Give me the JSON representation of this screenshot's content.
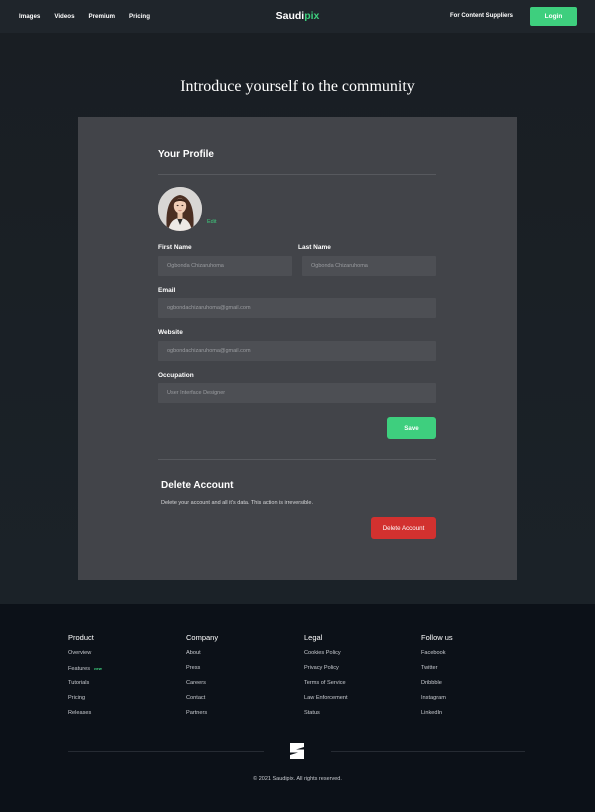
{
  "nav": {
    "links": [
      "Images",
      "Videos",
      "Premium",
      "Pricing"
    ],
    "brand_main": "Saudi",
    "brand_accent": "pix",
    "suppliers": "For Content Suppliers",
    "login": "Login"
  },
  "page": {
    "headline": "Introduce yourself to the community"
  },
  "profile": {
    "title": "Your Profile",
    "edit": "Edit",
    "first_name_label": "First Name",
    "first_name_value": "Ogbonda Chizaruhoma",
    "last_name_label": "Last Name",
    "last_name_value": "Ogbonda Chizaruhoma",
    "email_label": "Email",
    "email_value": "ogbondachizaruhoma@gmail.com",
    "website_label": "Website",
    "website_value": "ogbondachizaruhoma@gmail.com",
    "occupation_label": "Occupation",
    "occupation_value": "User Interface Designer",
    "save": "Save"
  },
  "delete": {
    "title": "Delete Account",
    "description": "Delete your account and all it's data. This action is irreversible.",
    "button": "Delete Account"
  },
  "footer": {
    "columns": [
      {
        "title": "Product",
        "items": [
          "Overview",
          "Features",
          "Tutorials",
          "Pricing",
          "Releases"
        ],
        "badge": "new"
      },
      {
        "title": "Company",
        "items": [
          "About",
          "Press",
          "Careers",
          "Contact",
          "Partners"
        ]
      },
      {
        "title": "Legal",
        "items": [
          "Cookies Policy",
          "Privacy Policy",
          "Terms of Service",
          "Law Enforcement",
          "Status"
        ]
      },
      {
        "title": "Follow us",
        "items": [
          "Facebook",
          "Twitter",
          "Dribbble",
          "Instagram",
          "LinkedIn"
        ]
      }
    ],
    "copyright": "© 2021 Saudipix. All rights reserved."
  },
  "colors": {
    "accent": "#3ecf7e",
    "danger": "#d2312f",
    "card": "#424449",
    "footer": "#0c1118"
  },
  "icons": {
    "logo": "saudipix-logo-icon",
    "avatar": "profile-photo"
  }
}
